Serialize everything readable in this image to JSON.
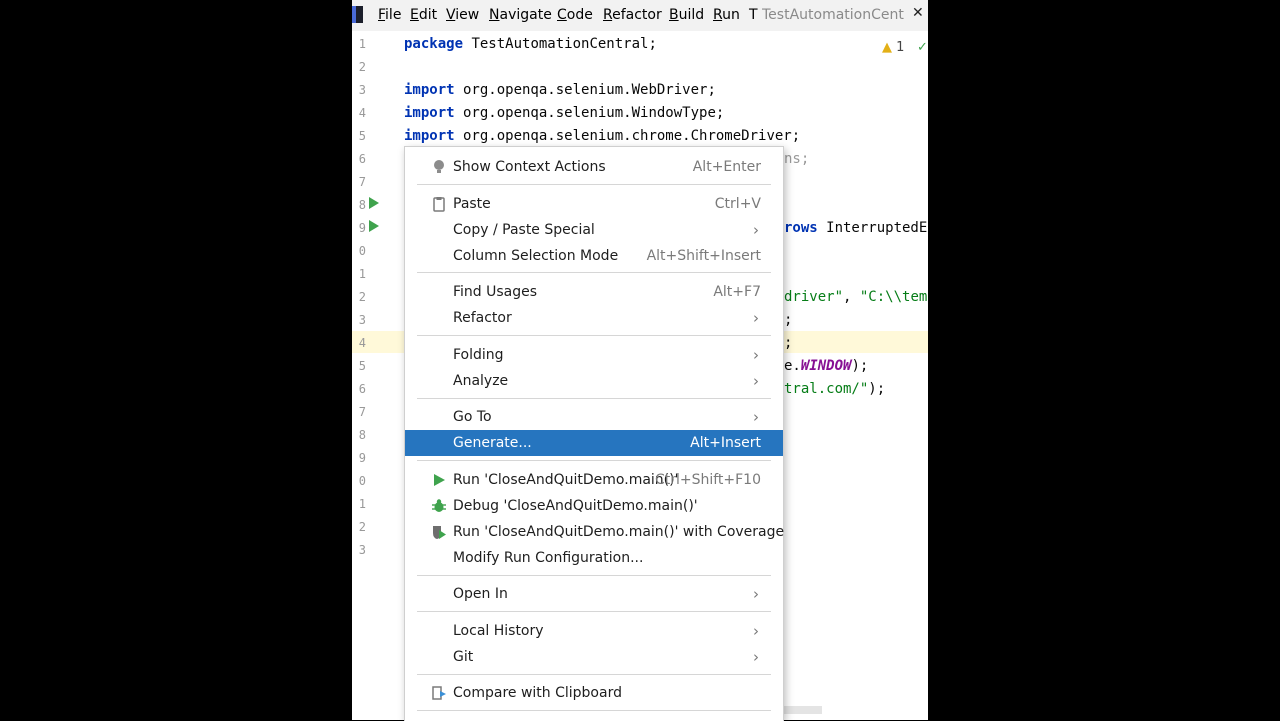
{
  "menubar": {
    "items": [
      {
        "label": "File",
        "mn": "F",
        "rest": "ile"
      },
      {
        "label": "Edit",
        "mn": "E",
        "rest": "dit"
      },
      {
        "label": "View",
        "mn": "V",
        "rest": "iew"
      },
      {
        "label": "Navigate",
        "mn": "N",
        "rest": "avigate"
      },
      {
        "label": "Code",
        "mn": "C",
        "rest": "ode"
      },
      {
        "label": "Refactor",
        "mn": "R",
        "rest": "efactor"
      },
      {
        "label": "Build",
        "mn": "B",
        "rest": "uild"
      },
      {
        "label": "Run",
        "mn": "R",
        "rest": "un"
      },
      {
        "label": "T",
        "mn": "T",
        "rest": ""
      }
    ],
    "window_title": "TestAutomationCentral",
    "close_glyph": "✕"
  },
  "editor": {
    "line_numbers": [
      "1",
      "2",
      "3",
      "4",
      "5",
      "6",
      "7",
      "8",
      "9",
      "0",
      "1",
      "2",
      "3",
      "4",
      "5",
      "6",
      "7",
      "8",
      "9",
      "0",
      "1",
      "2",
      "3"
    ],
    "line1": {
      "kw": "package",
      "rest": " TestAutomationCentral;"
    },
    "line3": {
      "kw": "import",
      "rest": " org.openqa.selenium.WebDriver;"
    },
    "line4": {
      "kw": "import",
      "rest": " org.openqa.selenium.WindowType;"
    },
    "line5": {
      "kw": "import",
      "rest": " org.openqa.selenium.chrome.ChromeDriver;"
    },
    "line6_tail": "ns;",
    "line9_tail_kw": "rows",
    "line9_tail": " InterruptedEx",
    "line12_tail_str1": "driver\"",
    "line12_tail_mid": ", ",
    "line12_tail_str2": "\"C:\\\\temp",
    "line13_tail": ";",
    "line14_tail": ";",
    "line15_tail_pre": "e.",
    "line15_tail_const": "WINDOW",
    "line15_tail_post": ");",
    "line16_tail_str": "tral.com/\"",
    "line16_tail_post": ");",
    "warning_count": "1"
  },
  "context_menu": {
    "show_context_actions": {
      "label": "Show Context Actions",
      "shortcut": "Alt+Enter"
    },
    "paste": {
      "label": "Paste",
      "shortcut": "Ctrl+V"
    },
    "copy_paste_special": {
      "label": "Copy / Paste Special"
    },
    "column_selection_mode": {
      "label": "Column Selection Mode",
      "shortcut": "Alt+Shift+Insert"
    },
    "find_usages": {
      "label": "Find Usages",
      "shortcut": "Alt+F7"
    },
    "refactor": {
      "label": "Refactor"
    },
    "folding": {
      "label": "Folding"
    },
    "analyze": {
      "label": "Analyze"
    },
    "go_to": {
      "label": "Go To"
    },
    "generate": {
      "label": "Generate...",
      "shortcut": "Alt+Insert"
    },
    "run": {
      "label": "Run 'CloseAndQuitDemo.main()'",
      "shortcut": "Ctrl+Shift+F10"
    },
    "debug": {
      "label": "Debug 'CloseAndQuitDemo.main()'"
    },
    "run_coverage": {
      "label": "Run 'CloseAndQuitDemo.main()' with Coverage"
    },
    "modify_run_config": {
      "label": "Modify Run Configuration..."
    },
    "open_in": {
      "label": "Open In"
    },
    "local_history": {
      "label": "Local History"
    },
    "git": {
      "label": "Git"
    },
    "compare_clipboard": {
      "label": "Compare with Clipboard"
    },
    "submenu_arrow": "›"
  },
  "colors": {
    "selection": "#2675bf",
    "keyword": "#0033b3",
    "string": "#067d17",
    "run_green": "#3fa34d"
  }
}
